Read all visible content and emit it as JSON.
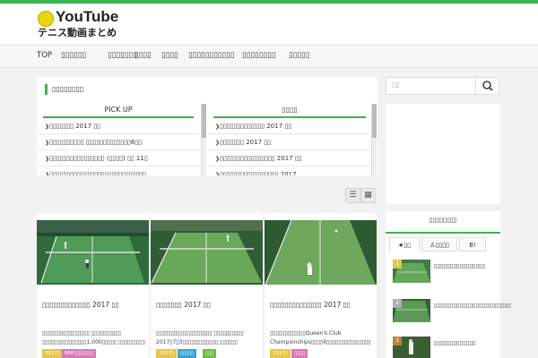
{
  "site": {
    "logo_title": "YouTube",
    "logo_subtitle": "テニス動画まとめ"
  },
  "nav": {
    "items": [
      "TOP",
      "▯▯▯▯▯▯",
      "▯▯▯▯▯▯▯",
      "▯▯▯▯",
      "▯▯▯▯",
      "▯▯▯▯▯▯▯▯▯▯▯",
      "▯▯▯▯▯▯▯▯",
      "▯▯▯▯▯"
    ]
  },
  "featured": {
    "title": "▯▯▯▯▯▯▯▯",
    "left_tab": {
      "label": "PICK UP",
      "rows": [
        "▯▯▯▯▯▯▯ 2017 ▯▯",
        "▯▯▯▯▯▯▯▯▯▯ ▯▯▯▯▯▯▯▯▯▯▯▯▯6▯▯",
        "▯▯▯▯▯▯▯▯▯▯▯▯▯▯▯▯ (▯▯▯▯) ▯▯ 11▯",
        "▯▯▯▯▯▯▯▯▯▯▯▯▯▯▯▯▯▯▯▯▯▯▯▯▯▯▯▯"
      ]
    },
    "right_tab": {
      "label": "▯▯▯▯",
      "rows": [
        "▯▯▯▯▯▯▯▯▯▯▯▯▯ 2017 ▯▯",
        "▯▯▯▯▯▯▯ 2017 ▯▯",
        "▯▯▯▯▯▯▯▯▯▯▯▯▯▯▯▯ 2017 ▯▯",
        "▯▯▯▯▯▯▯▯▯▯▯▯▯▯▯▯▯ 2017"
      ]
    }
  },
  "view_toggle": {
    "list_icon": "list-icon",
    "grid_icon": "grid-icon"
  },
  "cards": [
    {
      "title": "▯▯▯▯▯▯▯▯▯▯▯▯▯ 2017 ▯▯",
      "desc": "▯▯▯▯▯▯▯▯▯▯▯▯▯▯▯▯ ▯▯▯▯▯▯▯▯▯▯ ▯▯▯▯▯▯▯▯▯▯▯▯▯▯▯1,000▯▯▯▯▯ ▯▯▯▯▯▯▯▯▯",
      "tags": [
        {
          "label": "2017▯",
          "color": "#e5c64a"
        },
        {
          "label": "BNP▯▯▯▯▯▯▯",
          "color": "#d97ab6"
        }
      ]
    },
    {
      "title": "▯▯▯▯▯▯▯ 2017 ▯▯",
      "desc": "▯▯▯▯▯▯▯▯▯▯▯▯▯▯▯▯▯▯▯ ▯▯▯▯▯▯▯▯▯▯ 2017▯7▯3▯▯▯▯▯▯▯▯▯▯▯▯ ▯▯▯▯▯▯",
      "tags": [
        {
          "label": "2017▯",
          "color": "#e5c64a"
        },
        {
          "label": "▯▯▯▯▯",
          "color": "#3aa2d4"
        },
        {
          "label": "▯▯▯",
          "color": "#6cbf44"
        }
      ]
    },
    {
      "title": "▯▯▯▯▯▯▯▯▯▯▯▯▯▯ 2017 ▯▯",
      "desc": "▯▯▯▯▯▯▯▯▯▯▯▯Queen's Club Championships▯▯▯▯6▯▯▯▯▯▯▯▯▯▯▯▯▯▯▯",
      "tags": [
        {
          "label": "2017▯",
          "color": "#e5c64a"
        },
        {
          "label": "▯▯▯▯",
          "color": "#d97ab6"
        }
      ]
    }
  ],
  "sidebar": {
    "search_placeholder": "▯▯",
    "ranking_title": "▯▯▯▯▯▯▯▯",
    "ranking_tabs": [
      "★▯▯",
      "♙▯▯▯▯",
      "B!"
    ],
    "ranking_items": [
      {
        "rank": "1",
        "text": "▯▯▯▯▯▯▯▯▯▯▯▯▯▯▯▯",
        "color": "#e5c64a"
      },
      {
        "rank": "2",
        "text": "▯▯▯▯▯▯▯▯▯▯▯▯▯▯▯▯▯▯▯▯▯▯▯▯",
        "color": "#b0b0b0"
      },
      {
        "rank": "3",
        "text": "▯▯▯▯▯▯▯▯▯▯▯▯▯",
        "color": "#c08040"
      }
    ]
  },
  "colors": {
    "accent": "#3cb451"
  }
}
